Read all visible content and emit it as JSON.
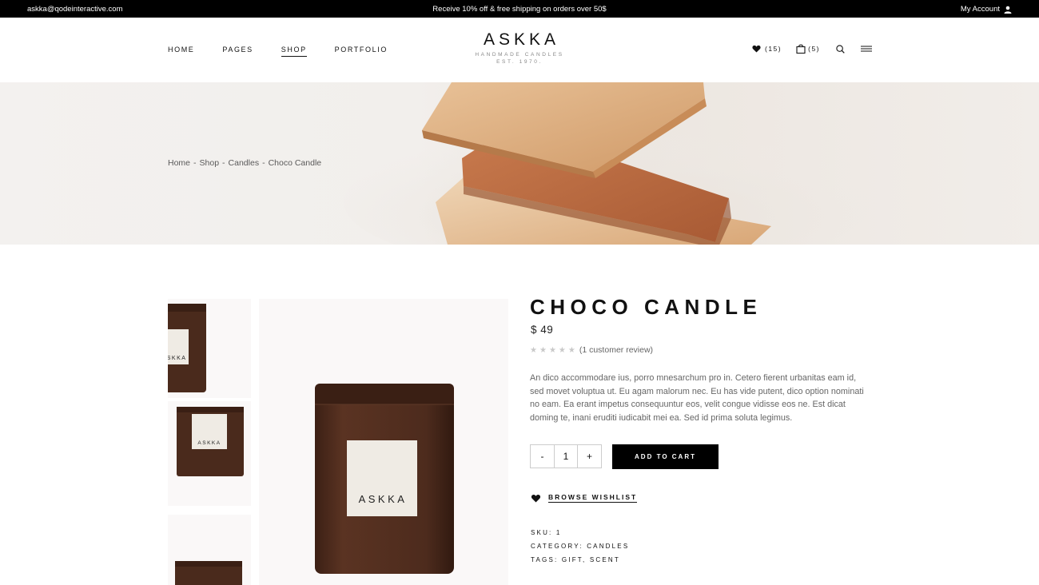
{
  "topbar": {
    "email": "askka@qodeinteractive.com",
    "promo": "Receive 10% off & free shipping on orders over 50$",
    "account": "My Account"
  },
  "nav": {
    "items": [
      "HOME",
      "PAGES",
      "SHOP",
      "PORTFOLIO"
    ],
    "active": "SHOP"
  },
  "logo": {
    "name": "ASKKA",
    "tagline": "HANDMADE CANDLES",
    "est": "EST. 1970."
  },
  "header_icons": {
    "wishlist_count": "(15)",
    "cart_count": "(5)"
  },
  "breadcrumb": {
    "items": [
      "Home",
      "Shop",
      "Candles",
      "Choco Candle"
    ],
    "separator": "-"
  },
  "product": {
    "title": "CHOCO CANDLE",
    "price": "$ 49",
    "rating_stars": 0,
    "reviews": "(1 customer review)",
    "description": "An dico accommodare ius, porro mnesarchum pro in. Cetero fierent urbanitas eam id, sed movet voluptua ut. Eu agam malorum nec. Eu has vide putent, dico option nominati no eam. Ea erant impetus consequuntur eos, velit congue vidisse eos ne. Est dicat doming te, inani eruditi iudicabit mei ea. Sed id prima soluta legimus.",
    "quantity": "1",
    "qty_minus": "-",
    "qty_plus": "+",
    "add_to_cart": "ADD TO CART",
    "browse_wishlist": "BROWSE WISHLIST",
    "sku_label": "SKU:",
    "sku": "1",
    "category_label": "CATEGORY:",
    "category": "CANDLES",
    "tags_label": "TAGS:",
    "tags": "GIFT, SCENT",
    "jar_label": "ASKKA"
  },
  "colors": {
    "black": "#000000",
    "jar_brown": "#4a2a1c",
    "label_cream": "#efebe4",
    "soap_orange": "#c8764a"
  }
}
